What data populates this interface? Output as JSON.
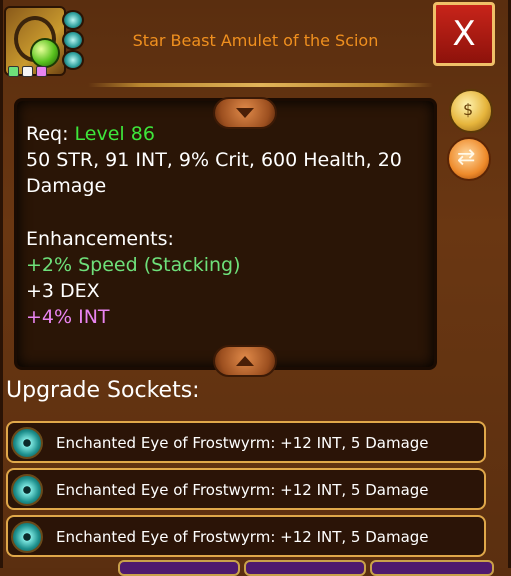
{
  "item": {
    "title": "Star Beast Amulet of the Scion",
    "icon_name": "amulet-icon",
    "chip_colors": [
      "#6ee07a",
      "#f5f5f5",
      "#e884f0"
    ]
  },
  "close_label": "X",
  "details": {
    "req_label": "Req:",
    "req_value": "Level 86",
    "stats_line1": "50 STR, 91 INT, 9% Crit, 600 Health, 20",
    "stats_line2": "Damage",
    "enh_header": "Enhancements:",
    "enh": [
      {
        "text": "+2% Speed (Stacking)",
        "color": "#6ee07a"
      },
      {
        "text": "+3 DEX",
        "color": "#ffffff"
      },
      {
        "text": "+4% INT",
        "color": "#e884f0"
      }
    ]
  },
  "sockets": {
    "header": "Upgrade Sockets:",
    "rows": [
      {
        "label": "Enchanted Eye of Frostwyrm: +12 INT, 5 Damage"
      },
      {
        "label": "Enchanted Eye of Frostwyrm: +12 INT, 5 Damage"
      },
      {
        "label": "Enchanted Eye of Frostwyrm: +12 INT, 5 Damage"
      }
    ]
  }
}
